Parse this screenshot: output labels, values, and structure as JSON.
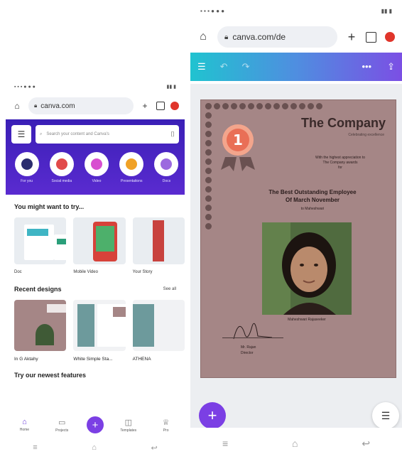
{
  "left": {
    "url": "canva.com",
    "search_placeholder": "Search your content and Canva's",
    "categories": [
      {
        "label": "For you",
        "color": "#2b2d6e"
      },
      {
        "label": "Social media",
        "color": "#e14a4a"
      },
      {
        "label": "Video",
        "color": "#d84fd0"
      },
      {
        "label": "Presentations",
        "color": "#f0a126"
      },
      {
        "label": "Docs",
        "color": "#9c6adf"
      }
    ],
    "try_title": "You might want to try...",
    "try_items": [
      {
        "label": "Doc"
      },
      {
        "label": "Mobile Video"
      },
      {
        "label": "Your Story"
      }
    ],
    "recent_title": "Recent designs",
    "see_all": "See all",
    "recent_items": [
      {
        "label": "In G Aktahy"
      },
      {
        "label": "White Simple Sta..."
      },
      {
        "label": "ATHENA"
      }
    ],
    "try_new": "Try our newest features",
    "nav": [
      {
        "label": "Home"
      },
      {
        "label": "Projects"
      },
      {
        "label": "Templates"
      },
      {
        "label": "Pro"
      }
    ]
  },
  "right": {
    "url": "canva.com/de",
    "certificate": {
      "company": "The Company",
      "company_sub": "Celebrating excellence",
      "intro": "With the highest appreciation to\nThe Company awards\nfor",
      "award_line1": "The Best Outstanding Employee",
      "award_line2": "Of March November",
      "award_sub": "to Maheshwari",
      "medal_number": "1",
      "employee_name": "Maheshwari Rajaseeker",
      "signer_name": "Mr. Rajan",
      "signer_title": "Director"
    }
  }
}
